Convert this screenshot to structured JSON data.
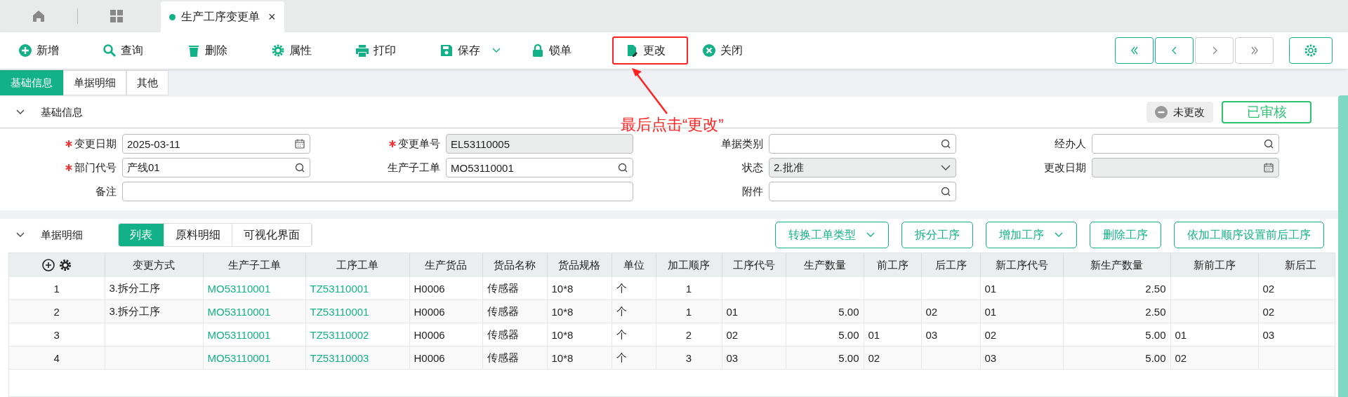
{
  "document_tab": {
    "title": "生产工序变更单",
    "close": "×"
  },
  "toolbar": [
    {
      "kind": "add",
      "label": "新增"
    },
    {
      "kind": "search",
      "label": "查询"
    },
    {
      "kind": "delete",
      "label": "删除"
    },
    {
      "kind": "properties",
      "label": "属性"
    },
    {
      "kind": "print",
      "label": "打印"
    },
    {
      "kind": "save",
      "label": "保存",
      "has_menu": true
    },
    {
      "kind": "lock",
      "label": "锁单"
    },
    {
      "kind": "change",
      "label": "更改",
      "annotated": true
    },
    {
      "kind": "close",
      "label": "关闭"
    }
  ],
  "nav_buttons": [
    {
      "kind": "first",
      "disabled": false
    },
    {
      "kind": "prev",
      "disabled": false
    },
    {
      "kind": "next",
      "disabled": true
    },
    {
      "kind": "last",
      "disabled": true
    }
  ],
  "annotation": {
    "text": "最后点击“更改”"
  },
  "form_tabs": [
    {
      "label": "基础信息",
      "selected": true
    },
    {
      "label": "单据明细",
      "selected": false
    },
    {
      "label": "其他",
      "selected": false
    }
  ],
  "basic_info": {
    "title": "基础信息",
    "change_status": "未更改",
    "audit_status": "已审核",
    "fields": [
      {
        "label": "变更日期",
        "required": true,
        "kind": "date",
        "value": "2025-03-11",
        "disabled": false
      },
      {
        "label": "变更单号",
        "required": true,
        "kind": "text",
        "value": "EL53110005",
        "disabled": true
      },
      {
        "label": "单据类别",
        "required": false,
        "kind": "lookup",
        "disabled": false
      },
      {
        "label": "经办人",
        "required": false,
        "kind": "lookup",
        "disabled": false
      },
      {
        "label": "部门代号",
        "required": true,
        "kind": "lookup",
        "value": "产线01",
        "disabled": false
      },
      {
        "label": "生产子工单",
        "required": false,
        "kind": "lookup",
        "value": "MO53110001",
        "disabled": false
      },
      {
        "label": "状态",
        "required": false,
        "kind": "select",
        "value": "2.批准",
        "disabled": true
      },
      {
        "label": "更改日期",
        "required": false,
        "kind": "date",
        "disabled": true
      },
      {
        "label": "备注",
        "required": false,
        "kind": "text",
        "wide": true,
        "disabled": false
      },
      {
        "label": "附件",
        "required": false,
        "kind": "lookup",
        "disabled": false
      }
    ]
  },
  "details": {
    "title": "单据明细",
    "view_tabs": [
      {
        "label": "列表",
        "selected": true
      },
      {
        "label": "原料明细",
        "selected": false
      },
      {
        "label": "可视化界面",
        "selected": false
      }
    ],
    "actions": [
      {
        "label": "转换工单类型",
        "has_menu": true
      },
      {
        "label": "拆分工序",
        "has_menu": false
      },
      {
        "label": "增加工序",
        "has_menu": true
      },
      {
        "label": "删除工序",
        "has_menu": false
      },
      {
        "label": "依加工顺序设置前后工序",
        "has_menu": false
      }
    ],
    "table": {
      "columns": [
        {
          "kind": "index"
        },
        {
          "label": "变更方式",
          "kind": "text"
        },
        {
          "label": "生产子工单",
          "kind": "link"
        },
        {
          "label": "工序工单",
          "kind": "link"
        },
        {
          "label": "生产货品",
          "kind": "text"
        },
        {
          "label": "货品名称",
          "kind": "text"
        },
        {
          "label": "货品规格",
          "kind": "text"
        },
        {
          "label": "单位",
          "kind": "text"
        },
        {
          "label": "加工顺序",
          "kind": "center"
        },
        {
          "label": "工序代号",
          "kind": "text"
        },
        {
          "label": "生产数量",
          "kind": "number"
        },
        {
          "label": "前工序",
          "kind": "text"
        },
        {
          "label": "后工序",
          "kind": "text"
        },
        {
          "label": "新工序代号",
          "kind": "text"
        },
        {
          "label": "新生产数量",
          "kind": "number"
        },
        {
          "label": "新前工序",
          "kind": "text"
        },
        {
          "label": "新后工",
          "kind": "text"
        }
      ],
      "rows": [
        [
          "1",
          "3.拆分工序",
          "MO53110001",
          "TZ53110001",
          "H0006",
          "传感器",
          "10*8",
          "个",
          "1",
          null,
          null,
          null,
          null,
          "01",
          "2.50",
          null,
          "02"
        ],
        [
          "2",
          "3.拆分工序",
          "MO53110001",
          "TZ53110001",
          "H0006",
          "传感器",
          "10*8",
          "个",
          "1",
          "01",
          "5.00",
          null,
          "02",
          "01",
          "2.50",
          null,
          "02"
        ],
        [
          "3",
          null,
          "MO53110001",
          "TZ53110002",
          "H0006",
          "传感器",
          "10*8",
          "个",
          "2",
          "02",
          "5.00",
          "01",
          "03",
          "02",
          "5.00",
          "01",
          "03"
        ],
        [
          "4",
          null,
          "MO53110001",
          "TZ53110003",
          "H0006",
          "传感器",
          "10*8",
          "个",
          "3",
          "03",
          "5.00",
          "02",
          null,
          "03",
          "5.00",
          "02",
          null
        ]
      ]
    }
  }
}
